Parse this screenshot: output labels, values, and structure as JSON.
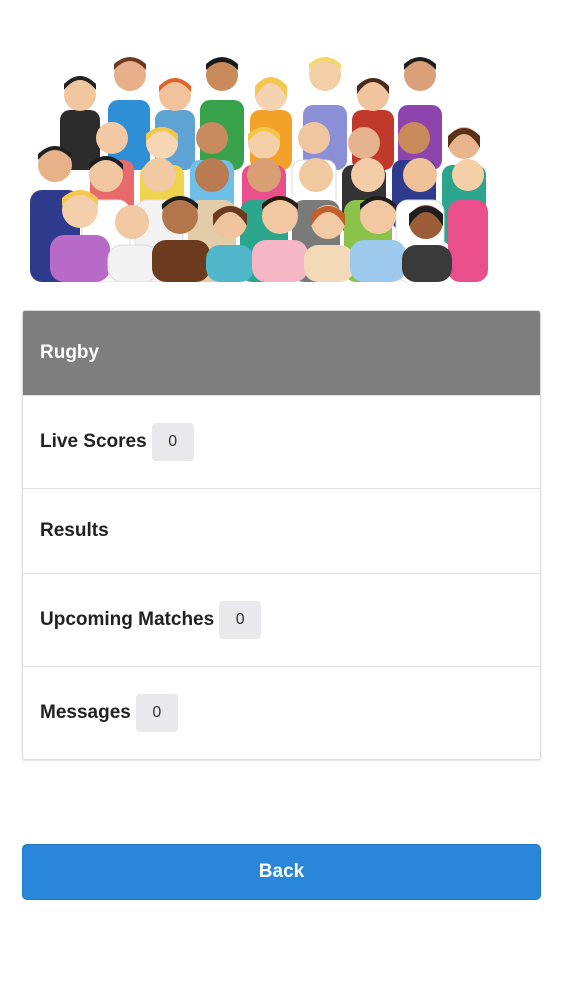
{
  "hero": {
    "image": "crowd-illustration"
  },
  "menu": {
    "title": "Rugby",
    "items": [
      {
        "label": "Live Scores",
        "count": "0"
      },
      {
        "label": "Results"
      },
      {
        "label": "Upcoming Matches",
        "count": "0"
      },
      {
        "label": "Messages",
        "count": "0"
      }
    ]
  },
  "actions": {
    "back_label": "Back"
  },
  "colors": {
    "header_bg": "#7e7e7e",
    "button_bg": "#2a86d8",
    "badge_bg": "#e9e9eb"
  }
}
